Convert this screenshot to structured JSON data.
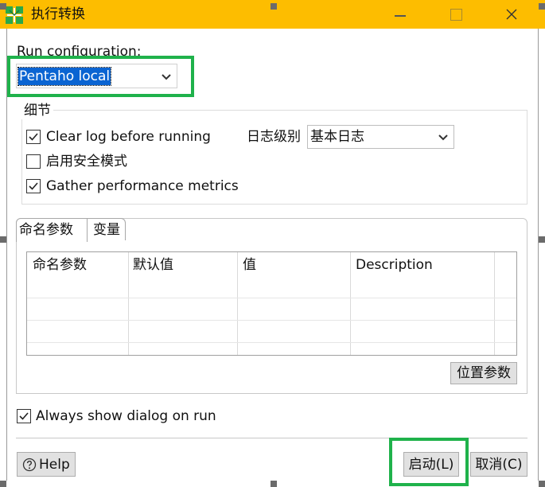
{
  "window": {
    "title": "执行转换"
  },
  "run_config": {
    "label": "Run configuration:",
    "selected": "Pentaho local"
  },
  "details": {
    "title": "细节",
    "clear_log": {
      "label": "Clear log before running",
      "checked": true
    },
    "safe_mode": {
      "label": "启用安全模式",
      "checked": false
    },
    "gather_metrics": {
      "label": "Gather performance metrics",
      "checked": true
    },
    "log_level": {
      "label": "日志级别",
      "value": "基本日志"
    }
  },
  "tabs": [
    {
      "label": "命名参数",
      "active": true
    },
    {
      "label": "变量",
      "active": false
    }
  ],
  "params_table": {
    "columns": [
      "命名参数",
      "默认值",
      "值",
      "Description"
    ],
    "rows": []
  },
  "position_params_button": "位置参数",
  "always_show": {
    "label": "Always show dialog on run",
    "checked": true
  },
  "buttons": {
    "help": "Help",
    "start": "启动(L)",
    "cancel": "取消(C)"
  },
  "colors": {
    "titlebar": "#fdbd00",
    "highlight": "#0a64d2",
    "annotation_box": "#1fb24b"
  }
}
